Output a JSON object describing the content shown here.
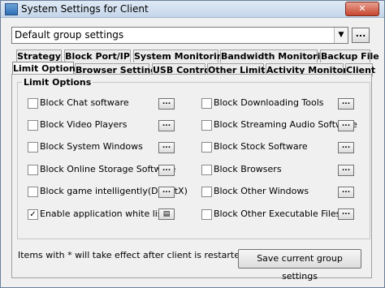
{
  "window": {
    "title": "System Settings for Client",
    "close_label": "✕"
  },
  "group_select": {
    "value": "Default group settings",
    "more_label": "..."
  },
  "tabs": {
    "row1": [
      "Strategy",
      "Block Port/IP",
      "System Monitoring",
      "Bandwidth Monitoring",
      "Backup File"
    ],
    "row2": [
      "Limit Options",
      "Browser Settings",
      "USB Control",
      "Other Limits",
      "Activity Monitoring",
      "Client"
    ],
    "active": "Limit Options"
  },
  "limit_options": {
    "group_title": "Limit Options",
    "button_label": "...",
    "left": [
      {
        "label": "Block Chat software",
        "checked": false
      },
      {
        "label": "Block Video Players",
        "checked": false
      },
      {
        "label": "Block System Windows",
        "checked": false
      },
      {
        "label": "Block Online Storage Software",
        "checked": false
      },
      {
        "label": "Block game intelligently(DirectX)",
        "checked": false
      },
      {
        "label": "Enable application white list",
        "checked": true
      }
    ],
    "right": [
      {
        "label": "Block Downloading Tools",
        "checked": false
      },
      {
        "label": "Block Streaming Audio Software",
        "checked": false
      },
      {
        "label": "Block Stock Software",
        "checked": false
      },
      {
        "label": "Block Browsers",
        "checked": false
      },
      {
        "label": "Block Other Windows",
        "checked": false
      },
      {
        "label": "Block Other Executable Files",
        "checked": false
      }
    ]
  },
  "footer": {
    "note": "Items with * will take effect after client is restarted",
    "save_label": "Save current group settings"
  }
}
